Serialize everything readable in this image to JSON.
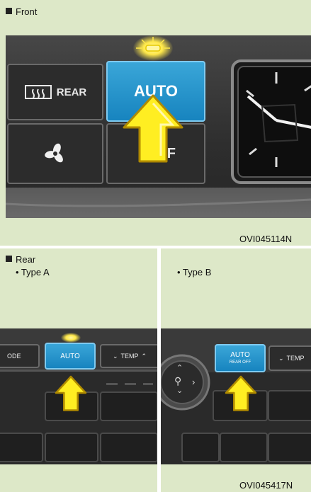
{
  "front": {
    "heading": "Front",
    "rear_button_label": "REAR",
    "auto_button_label": "AUTO",
    "f_label": "F",
    "image_code": "OVI045114N",
    "icons": [
      "rear-defrost-icon",
      "fan-icon",
      "arrow-up-icon",
      "indicator-light-icon",
      "clock-icon"
    ]
  },
  "rear": {
    "heading": "Rear",
    "type_a": {
      "label": "• Type A",
      "mode_label": "ODE",
      "auto_label": "AUTO",
      "temp_label": "TEMP"
    },
    "type_b": {
      "label": "• Type B",
      "auto_label": "AUTO",
      "auto_sub_label": "REAR OFF",
      "temp_label": "TEMP"
    },
    "image_code": "OVI045417N"
  },
  "colors": {
    "panel": "#dde8c8",
    "button_blue": "#1784bf",
    "arrow_yellow": "#ffee22"
  }
}
